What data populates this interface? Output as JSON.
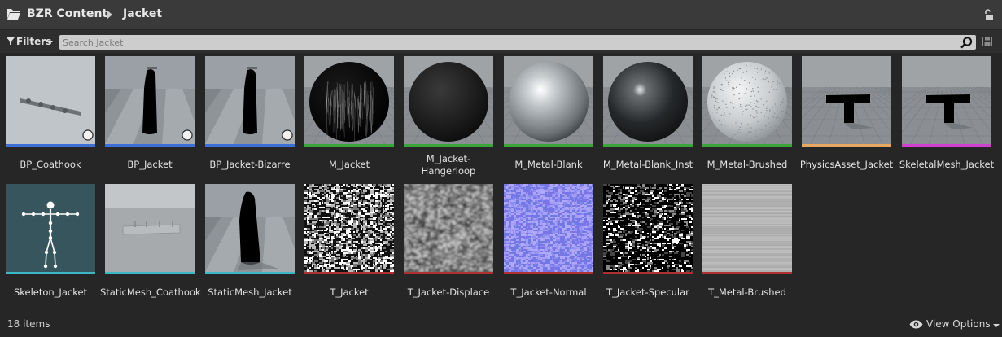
{
  "breadcrumb": {
    "root": "BZR Content",
    "current": "Jacket"
  },
  "filters": {
    "label": "Filters"
  },
  "search": {
    "placeholder": "Search Jacket",
    "value": ""
  },
  "assets": [
    {
      "label": "BP_Coathook",
      "type_color": "#3d6fd6",
      "thumb": "coathook"
    },
    {
      "label": "BP_Jacket",
      "type_color": "#3d6fd6",
      "thumb": "jacket-blueprint"
    },
    {
      "label": "BP_Jacket-Bizarre",
      "type_color": "#3d6fd6",
      "thumb": "jacket-blueprint"
    },
    {
      "label": "M_Jacket",
      "type_color": "#3aa53a",
      "thumb": "sphere-dark-noise"
    },
    {
      "label": "M_Jacket-Hangerloop",
      "type_color": "#3aa53a",
      "thumb": "sphere-black"
    },
    {
      "label": "M_Metal-Blank",
      "type_color": "#3aa53a",
      "thumb": "sphere-silver"
    },
    {
      "label": "M_Metal-Blank_Inst",
      "type_color": "#3aa53a",
      "thumb": "sphere-dark-glossy"
    },
    {
      "label": "M_Metal-Brushed",
      "type_color": "#3aa53a",
      "thumb": "sphere-brushed"
    },
    {
      "label": "PhysicsAsset_Jacket",
      "type_color": "#e8a860",
      "thumb": "t-shape"
    },
    {
      "label": "SkeletalMesh_Jacket",
      "type_color": "#d040d0",
      "thumb": "t-shape"
    },
    {
      "label": "Skeleton_Jacket",
      "type_color": "#3ab8c8",
      "thumb": "skeleton"
    },
    {
      "label": "StaticMesh_Coathook",
      "type_color": "#3ab8c8",
      "thumb": "coathook-floor"
    },
    {
      "label": "StaticMesh_Jacket",
      "type_color": "#3ab8c8",
      "thumb": "jacket-floor"
    },
    {
      "label": "T_Jacket",
      "type_color": "#b03030",
      "thumb": "noise-bw"
    },
    {
      "label": "T_Jacket-Displace",
      "type_color": "#b03030",
      "thumb": "noise-blur"
    },
    {
      "label": "T_Jacket-Normal",
      "type_color": "#b03030",
      "thumb": "noise-normal"
    },
    {
      "label": "T_Jacket-Specular",
      "type_color": "#b03030",
      "thumb": "noise-spec"
    },
    {
      "label": "T_Metal-Brushed",
      "type_color": "#b03030",
      "thumb": "brushed-flat"
    }
  ],
  "status": {
    "item_count": "18 items",
    "view_options_label": "View Options"
  }
}
